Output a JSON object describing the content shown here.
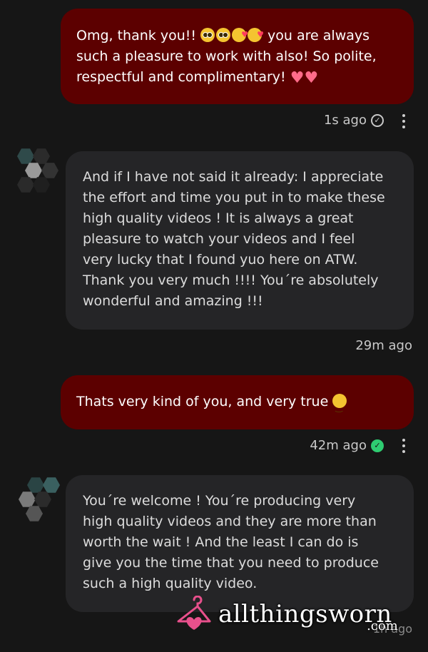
{
  "messages": [
    {
      "direction": "sent",
      "text_before_emoji": "Omg, thank you!! ",
      "emoji_names": [
        "pleading-face-icon",
        "pleading-face-icon",
        "smiling-face-with-hearts-icon",
        "smiling-face-with-hearts-icon"
      ],
      "text_after_emoji_line1": " you are always",
      "line2": "such a pleasure to work with also! So polite,",
      "line3_text": "respectful and complimentary! ",
      "trailing_icons": [
        "pink-heart-icon",
        "pink-heart-icon"
      ],
      "time": "1s ago",
      "status_icon": "sent-check-icon"
    },
    {
      "direction": "received",
      "lines": [
        "And if I have not said it already: I appreciate",
        "the effort and time you put in to make these",
        "high quality videos ! It is always a great",
        "pleasure to watch your videos and I feel",
        "very lucky that I found yuo here on ATW.",
        "Thank you very much !!!! You´re absolutely",
        "wonderful and amazing !!!"
      ],
      "time": "29m ago"
    },
    {
      "direction": "sent",
      "text": "Thats very kind of you, and very true ",
      "emoji_name": "smiling-blush-face-icon",
      "time": "42m ago",
      "status_icon": "read-check-icon"
    },
    {
      "direction": "received",
      "lines": [
        "You´re welcome ! You´re producing very",
        "high quality videos and they are more than",
        "worth the wait ! And the least I can do is",
        "give you the time that you need to produce",
        "such a high quality video."
      ],
      "time": "1h ago"
    }
  ],
  "watermark": {
    "brand": "allthingsworn",
    "suffix": ".com",
    "icon": "hanger-heart-logo-icon"
  },
  "colors": {
    "background": "#161616",
    "sent_bubble": "#5c0000",
    "received_bubble": "#252527",
    "read_check": "#2ecc71",
    "heart": "#ff6b8a",
    "logo": "#e8508c"
  }
}
